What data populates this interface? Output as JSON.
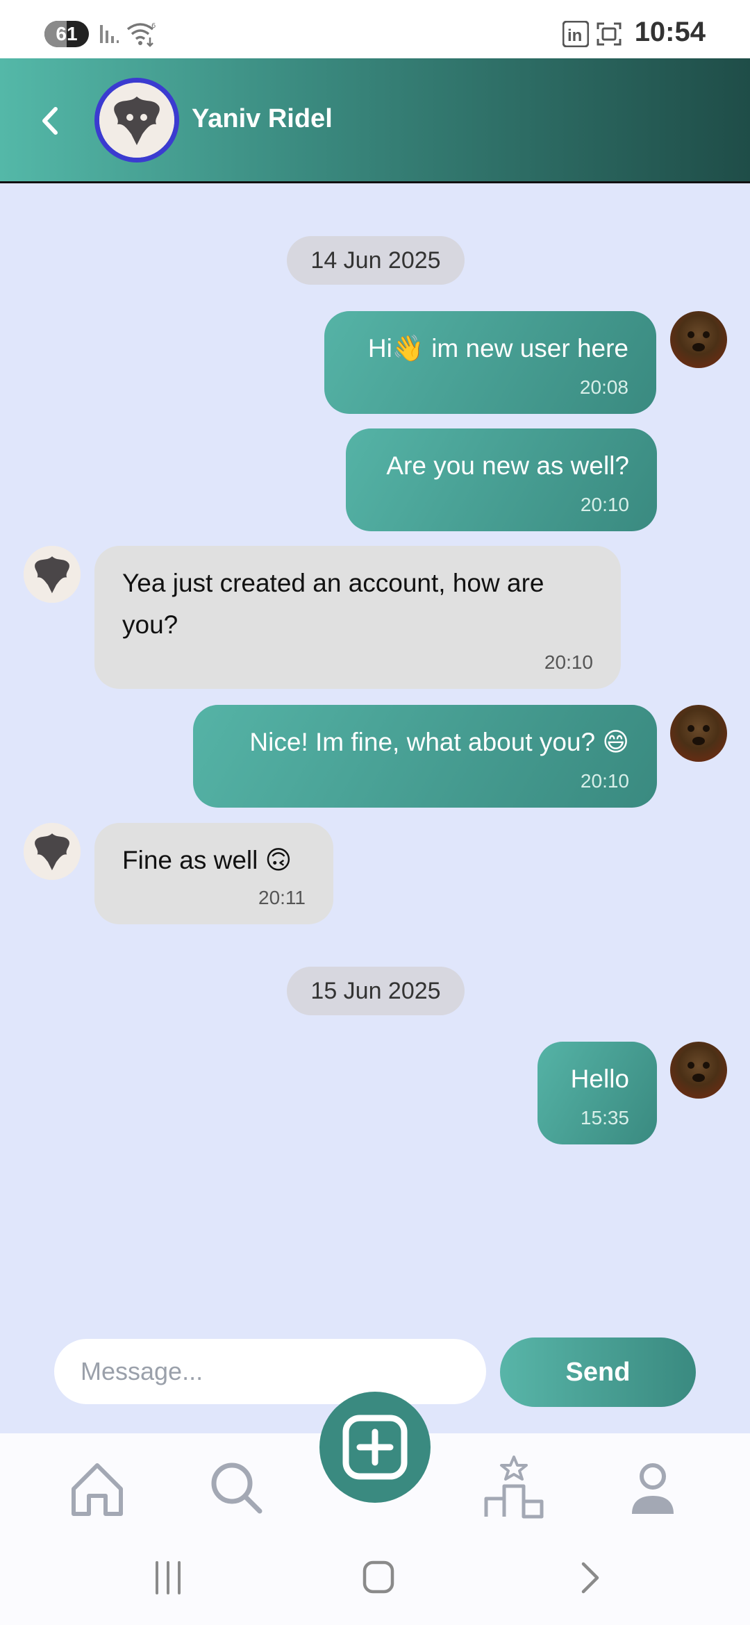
{
  "status_bar": {
    "battery_level": "61",
    "time": "10:54"
  },
  "header": {
    "contact_name": "Yaniv Ridel"
  },
  "messages": [
    {
      "type": "date",
      "label": "14 Jun 2025"
    },
    {
      "direction": "out",
      "text": "Hi👋 im new user here",
      "time": "20:08"
    },
    {
      "direction": "out",
      "text": "Are you new as well?",
      "time": "20:10"
    },
    {
      "direction": "in",
      "text": "Yea just created an account, how are you?",
      "time": "20:10"
    },
    {
      "direction": "out",
      "text": "Nice! Im fine, what about you? 😄",
      "time": "20:10"
    },
    {
      "direction": "in",
      "text": "Fine as well 🙃",
      "time": "20:11"
    },
    {
      "type": "date",
      "label": "15 Jun 2025"
    },
    {
      "direction": "out",
      "text": "Hello",
      "time": "15:35"
    }
  ],
  "composer": {
    "placeholder": "Message...",
    "value": "",
    "send_label": "Send"
  },
  "colors": {
    "accent": "#3a8a80",
    "chat_background": "#e0e6fb",
    "incoming_bubble": "#e0e0e0",
    "avatar_ring": "#3b3bd0"
  },
  "nav": {
    "items": [
      "home-icon",
      "search-icon",
      "add-post-icon",
      "leaderboard-icon",
      "profile-icon"
    ]
  }
}
